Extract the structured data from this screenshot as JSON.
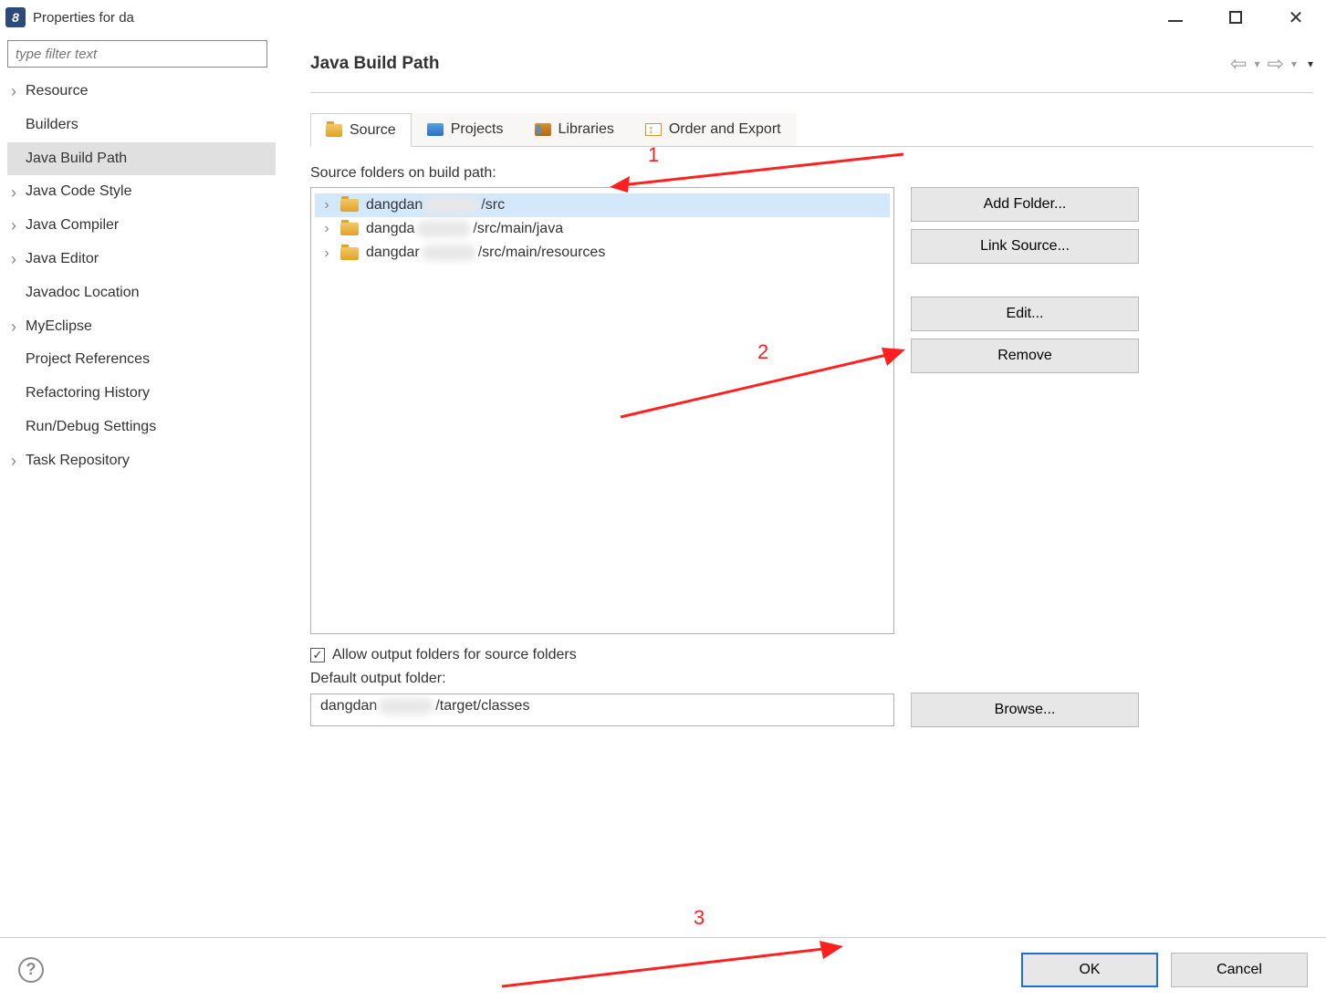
{
  "window": {
    "title": "Properties for da"
  },
  "filter_placeholder": "type filter text",
  "sidebar": [
    {
      "label": "Resource",
      "expandable": true
    },
    {
      "label": "Builders",
      "expandable": false
    },
    {
      "label": "Java Build Path",
      "expandable": false,
      "selected": true
    },
    {
      "label": "Java Code Style",
      "expandable": true
    },
    {
      "label": "Java Compiler",
      "expandable": true
    },
    {
      "label": "Java Editor",
      "expandable": true
    },
    {
      "label": "Javadoc Location",
      "expandable": false
    },
    {
      "label": "MyEclipse",
      "expandable": true
    },
    {
      "label": "Project References",
      "expandable": false
    },
    {
      "label": "Refactoring History",
      "expandable": false
    },
    {
      "label": "Run/Debug Settings",
      "expandable": false
    },
    {
      "label": "Task Repository",
      "expandable": true
    }
  ],
  "page_title": "Java Build Path",
  "tabs": [
    {
      "label": "Source",
      "icon": "folder",
      "active": true
    },
    {
      "label": "Projects",
      "icon": "projects",
      "active": false
    },
    {
      "label": "Libraries",
      "icon": "lib",
      "active": false
    },
    {
      "label": "Order and Export",
      "icon": "order",
      "active": false
    }
  ],
  "source": {
    "label": "Source folders on build path:",
    "items": [
      {
        "pre": "dangdan",
        "post": "/src",
        "selected": true
      },
      {
        "pre": "dangda",
        "post": "/src/main/java",
        "selected": false
      },
      {
        "pre": "dangdar",
        "post": "/src/main/resources",
        "selected": false
      }
    ]
  },
  "buttons": {
    "add_folder": "Add Folder...",
    "link_source": "Link Source...",
    "edit": "Edit...",
    "remove": "Remove"
  },
  "allow_output": {
    "checked": true,
    "label": "Allow output folders for source folders"
  },
  "default_output": {
    "label": "Default output folder:",
    "pre": "dangdan",
    "post": "/target/classes",
    "browse": "Browse..."
  },
  "footer": {
    "ok": "OK",
    "cancel": "Cancel"
  },
  "annotations": {
    "a1": "1",
    "a2": "2",
    "a3": "3"
  }
}
